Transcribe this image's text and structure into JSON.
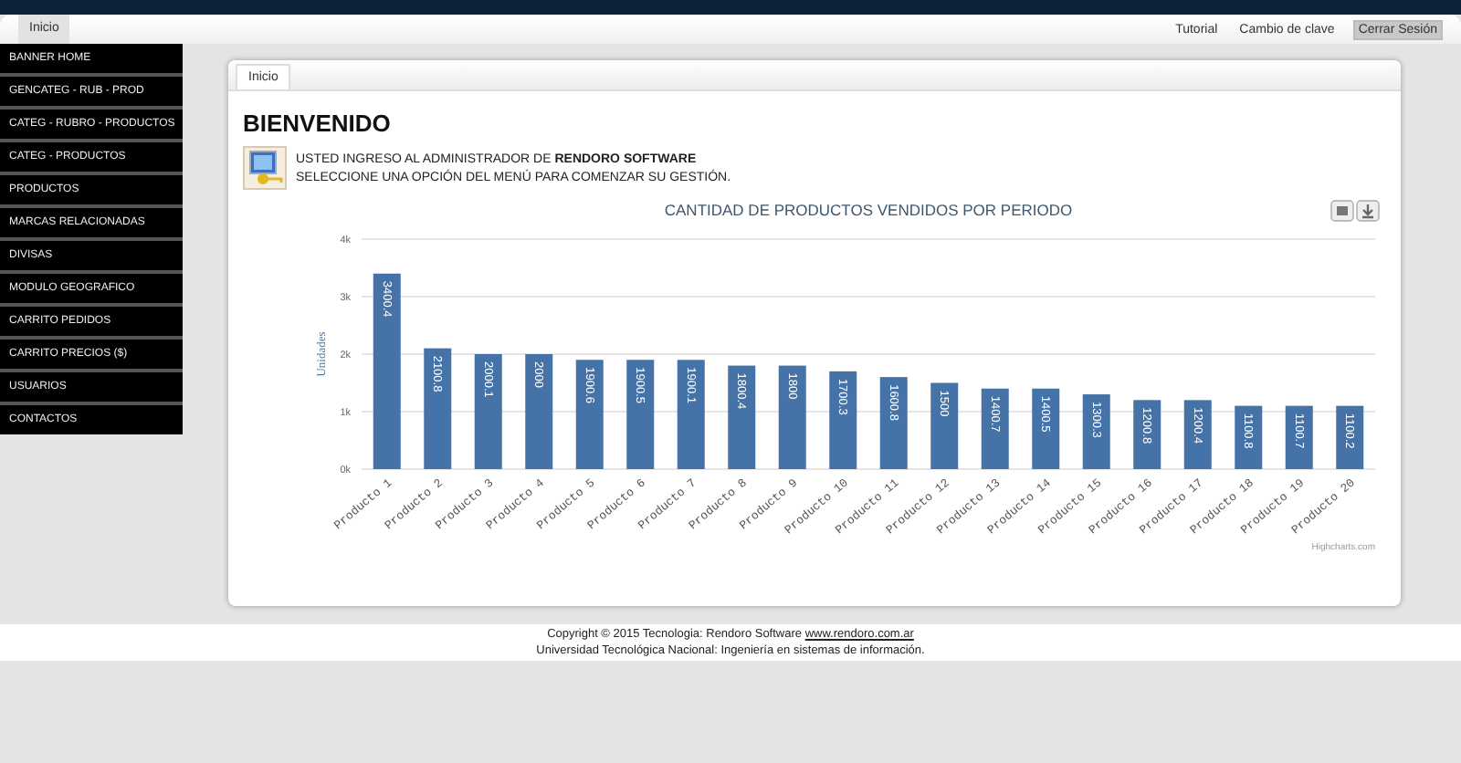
{
  "header": {
    "tabs": [
      {
        "label": "Inicio",
        "selected": true
      }
    ],
    "links": [
      {
        "label": "Tutorial",
        "kind": "link"
      },
      {
        "label": "Cambio de clave",
        "kind": "link"
      },
      {
        "label": "Cerrar Sesión",
        "kind": "button"
      }
    ]
  },
  "sidebar": {
    "items": [
      "BANNER HOME",
      "GENCATEG - RUB - PROD",
      "CATEG - RUBRO - PRODUCTOS",
      "CATEG - PRODUCTOS",
      "PRODUCTOS",
      "MARCAS RELACIONADAS",
      "DIVISAS",
      "MODULO GEOGRAFICO",
      "CARRITO PEDIDOS",
      "CARRITO PRECIOS ($)",
      "USUARIOS",
      "CONTACTOS"
    ]
  },
  "panel": {
    "tab": "Inicio",
    "title": "BIENVENIDO",
    "message": [
      "USTED INGRESO AL ADMINISTRADOR DE **RENDORO SOFTWARE**",
      "SELECCIONE UNA OPCIÓN DEL MENÚ PARA COMENZAR SU GESTIÓN."
    ],
    "chart": {
      "credit": "Highcharts.com",
      "chart_data": {
        "type": "bar",
        "title": "CANTIDAD DE PRODUCTOS VENDIDOS POR PERIODO",
        "ylabel": "Unidades",
        "categories": [
          "Producto 1",
          "Producto 2",
          "Producto 3",
          "Producto 4",
          "Producto 5",
          "Producto 6",
          "Producto 7",
          "Producto 8",
          "Producto 9",
          "Producto 10",
          "Producto 11",
          "Producto 12",
          "Producto 13",
          "Producto 14",
          "Producto 15",
          "Producto 16",
          "Producto 17",
          "Producto 18",
          "Producto 19",
          "Producto 20"
        ],
        "values": [
          3400.4,
          2100.8,
          2000.1,
          2000,
          1900.6,
          1900.5,
          1900.1,
          1800.4,
          1800,
          1700.3,
          1600.8,
          1500,
          1400.7,
          1400.5,
          1300.3,
          1200.8,
          1200.4,
          1100.8,
          1100.7,
          1100.2
        ],
        "ylim": [
          0,
          4000
        ],
        "yticks": [
          {
            "value": 0,
            "label": "0k"
          },
          {
            "value": 1000,
            "label": "1k"
          },
          {
            "value": 2000,
            "label": "2k"
          },
          {
            "value": 3000,
            "label": "3k"
          },
          {
            "value": 4000,
            "label": "4k"
          }
        ],
        "grid": true,
        "data_labels": true
      }
    }
  },
  "footer": {
    "lines": [
      {
        "text": "Copyright © 2015 Tecnologia: Rendoro Software ",
        "link": "www.rendoro.com.ar"
      },
      {
        "text": "Universidad Tecnológica Nacional: Ingeniería en sistemas de información."
      }
    ]
  }
}
